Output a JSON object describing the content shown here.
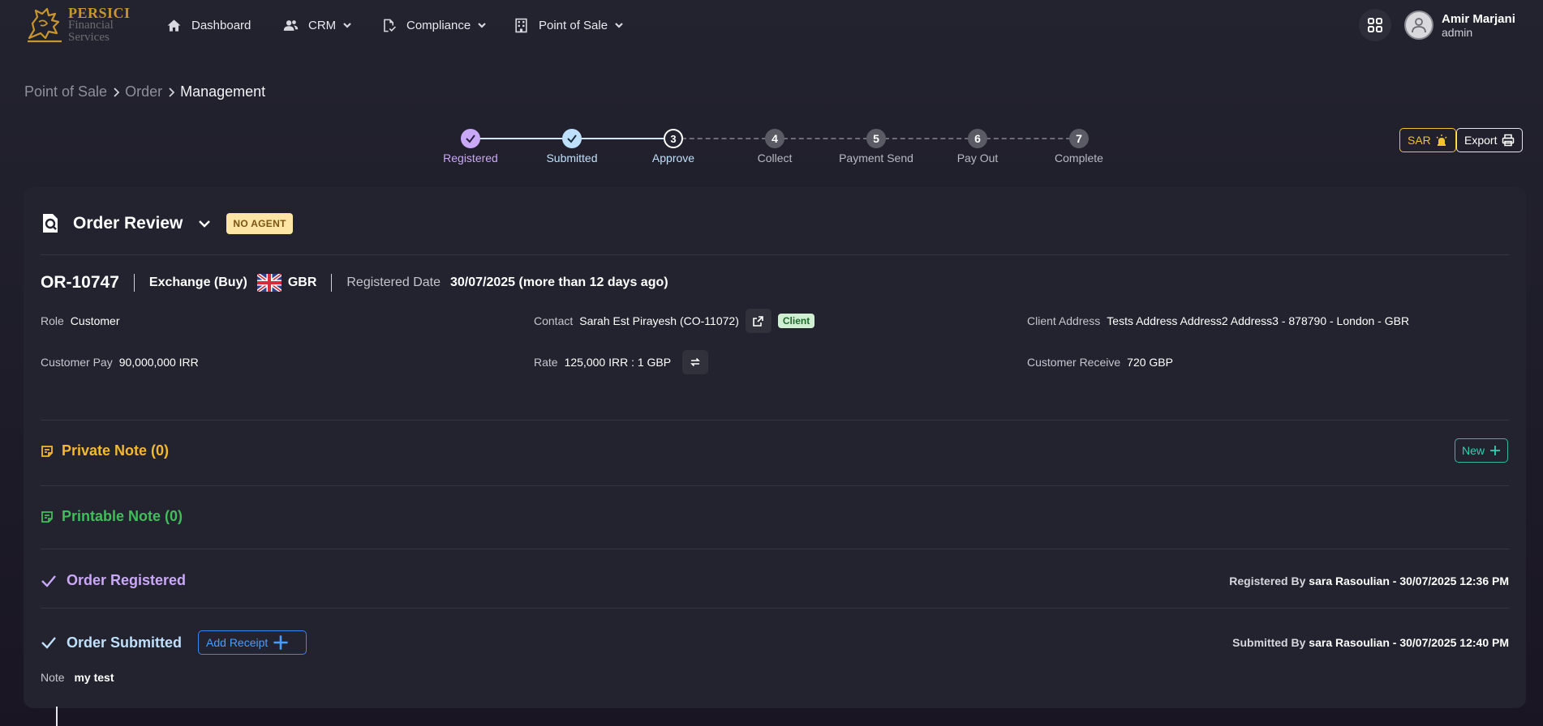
{
  "brand": {
    "line1": "PERSICI",
    "line2": "Financial",
    "line3": "Services"
  },
  "nav": {
    "dashboard": "Dashboard",
    "crm": "CRM",
    "compliance": "Compliance",
    "pos": "Point of Sale"
  },
  "user": {
    "name": "Amir Marjani",
    "role": "admin"
  },
  "breadcrumb": {
    "level1": "Point of Sale",
    "level2": "Order",
    "current": "Management"
  },
  "stepper": {
    "steps": [
      {
        "num": "",
        "label": "Registered",
        "state": "done",
        "color": "#c9a8f7"
      },
      {
        "num": "",
        "label": "Submitted",
        "state": "done",
        "color": "#bfe0fb"
      },
      {
        "num": "3",
        "label": "Approve",
        "state": "current",
        "color": "#bfe0fb"
      },
      {
        "num": "4",
        "label": "Collect",
        "state": "pending"
      },
      {
        "num": "5",
        "label": "Payment Send",
        "state": "pending"
      },
      {
        "num": "6",
        "label": "Pay Out",
        "state": "pending"
      },
      {
        "num": "7",
        "label": "Complete",
        "state": "pending"
      }
    ]
  },
  "actions": {
    "sar": "SAR",
    "export": "Export"
  },
  "review": {
    "title": "Order Review",
    "badge": "NO AGENT",
    "order_id": "OR-10747",
    "exchange_type": "Exchange (Buy)",
    "currency": "GBR",
    "registered_date_label": "Registered Date",
    "registered_date": "30/07/2025 (more than 12 days ago)",
    "role_label": "Role",
    "role": "Customer",
    "contact_label": "Contact",
    "contact": "Sarah Est Pirayesh (CO-11072)",
    "contact_badge": "Client",
    "address_label": "Client Address",
    "address": "Tests Address Address2 Address3 - 878790 - London - GBR",
    "customer_pay_label": "Customer Pay",
    "customer_pay": "90,000,000 IRR",
    "rate_label": "Rate",
    "rate": "125,000 IRR : 1 GBP",
    "customer_receive_label": "Customer Receive",
    "customer_receive": "720 GBP"
  },
  "notes": {
    "private": "Private Note (0)",
    "printable": "Printable Note (0)",
    "new_btn": "New"
  },
  "history": {
    "registered": {
      "title": "Order Registered",
      "by_label": "Registered By",
      "by": "sara Rasoulian - 30/07/2025 12:36 PM"
    },
    "submitted": {
      "title": "Order Submitted",
      "add_receipt": "Add Receipt",
      "by_label": "Submitted By",
      "by": "sara Rasoulian - 30/07/2025 12:40 PM",
      "note_label": "Note",
      "note": "my test"
    }
  },
  "colors": {
    "accent_purple": "#c9a8f7",
    "accent_blue": "#bfe0fb",
    "private_note": "#f5b82e",
    "printable_note": "#3fbf5a",
    "sar": "#f2c230",
    "new_teal": "#2fd1b2",
    "add_receipt_blue": "#4c9cff"
  },
  "icons": {
    "dashboard": "home-icon",
    "crm": "users-icon",
    "compliance": "file-check-icon",
    "pos": "building-icon",
    "apps": "grid-icon",
    "review": "search-document-icon"
  }
}
